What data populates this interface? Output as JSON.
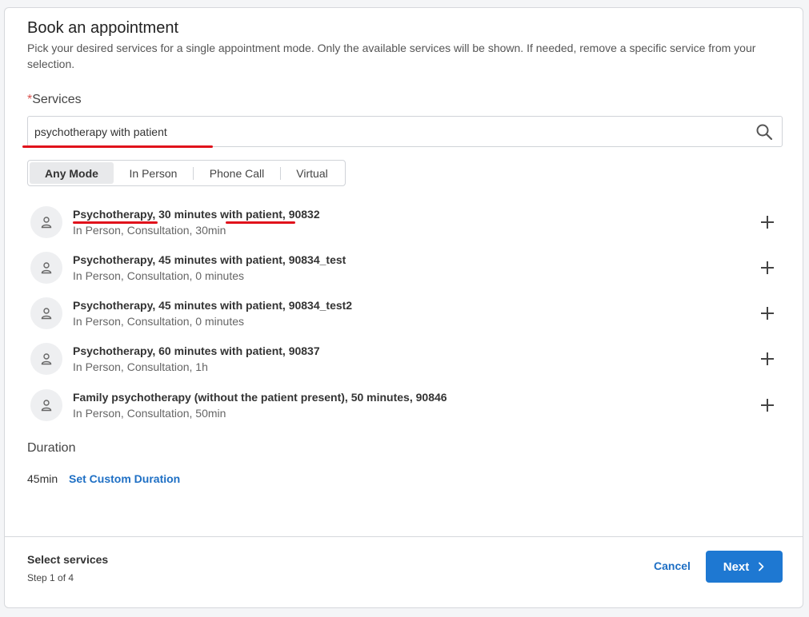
{
  "header": {
    "title": "Book an appointment",
    "description": "Pick your desired services for a single appointment mode. Only the available services will be shown. If needed, remove a specific service from your selection."
  },
  "services": {
    "required_mark": "*",
    "label": "Services",
    "search_value": "psychotherapy with patient"
  },
  "modes": [
    {
      "label": "Any Mode",
      "active": true
    },
    {
      "label": "In Person",
      "active": false
    },
    {
      "label": "Phone Call",
      "active": false
    },
    {
      "label": "Virtual",
      "active": false
    }
  ],
  "service_list": [
    {
      "name": "Psychotherapy, 30 minutes with patient, 90832",
      "meta": "In Person, Consultation, 30min"
    },
    {
      "name": "Psychotherapy, 45 minutes with patient, 90834_test",
      "meta": "In Person, Consultation, 0 minutes"
    },
    {
      "name": "Psychotherapy, 45 minutes with patient, 90834_test2",
      "meta": "In Person, Consultation, 0 minutes"
    },
    {
      "name": "Psychotherapy, 60 minutes with patient, 90837",
      "meta": "In Person, Consultation, 1h"
    },
    {
      "name": "Family psychotherapy (without the patient present), 50 minutes, 90846",
      "meta": "In Person, Consultation, 50min"
    }
  ],
  "duration": {
    "label": "Duration",
    "value": "45min",
    "custom_link": "Set Custom Duration"
  },
  "footer": {
    "step_title": "Select services",
    "step_sub": "Step 1 of 4",
    "cancel_label": "Cancel",
    "next_label": "Next"
  },
  "icons": {
    "search": "search-icon",
    "avatar": "person-icon",
    "add": "plus-icon",
    "next": "chevron-right-icon"
  },
  "colors": {
    "accent": "#1e78d2",
    "link": "#1e6fc4",
    "annotation": "#e0121b",
    "required": "#d9534f"
  }
}
